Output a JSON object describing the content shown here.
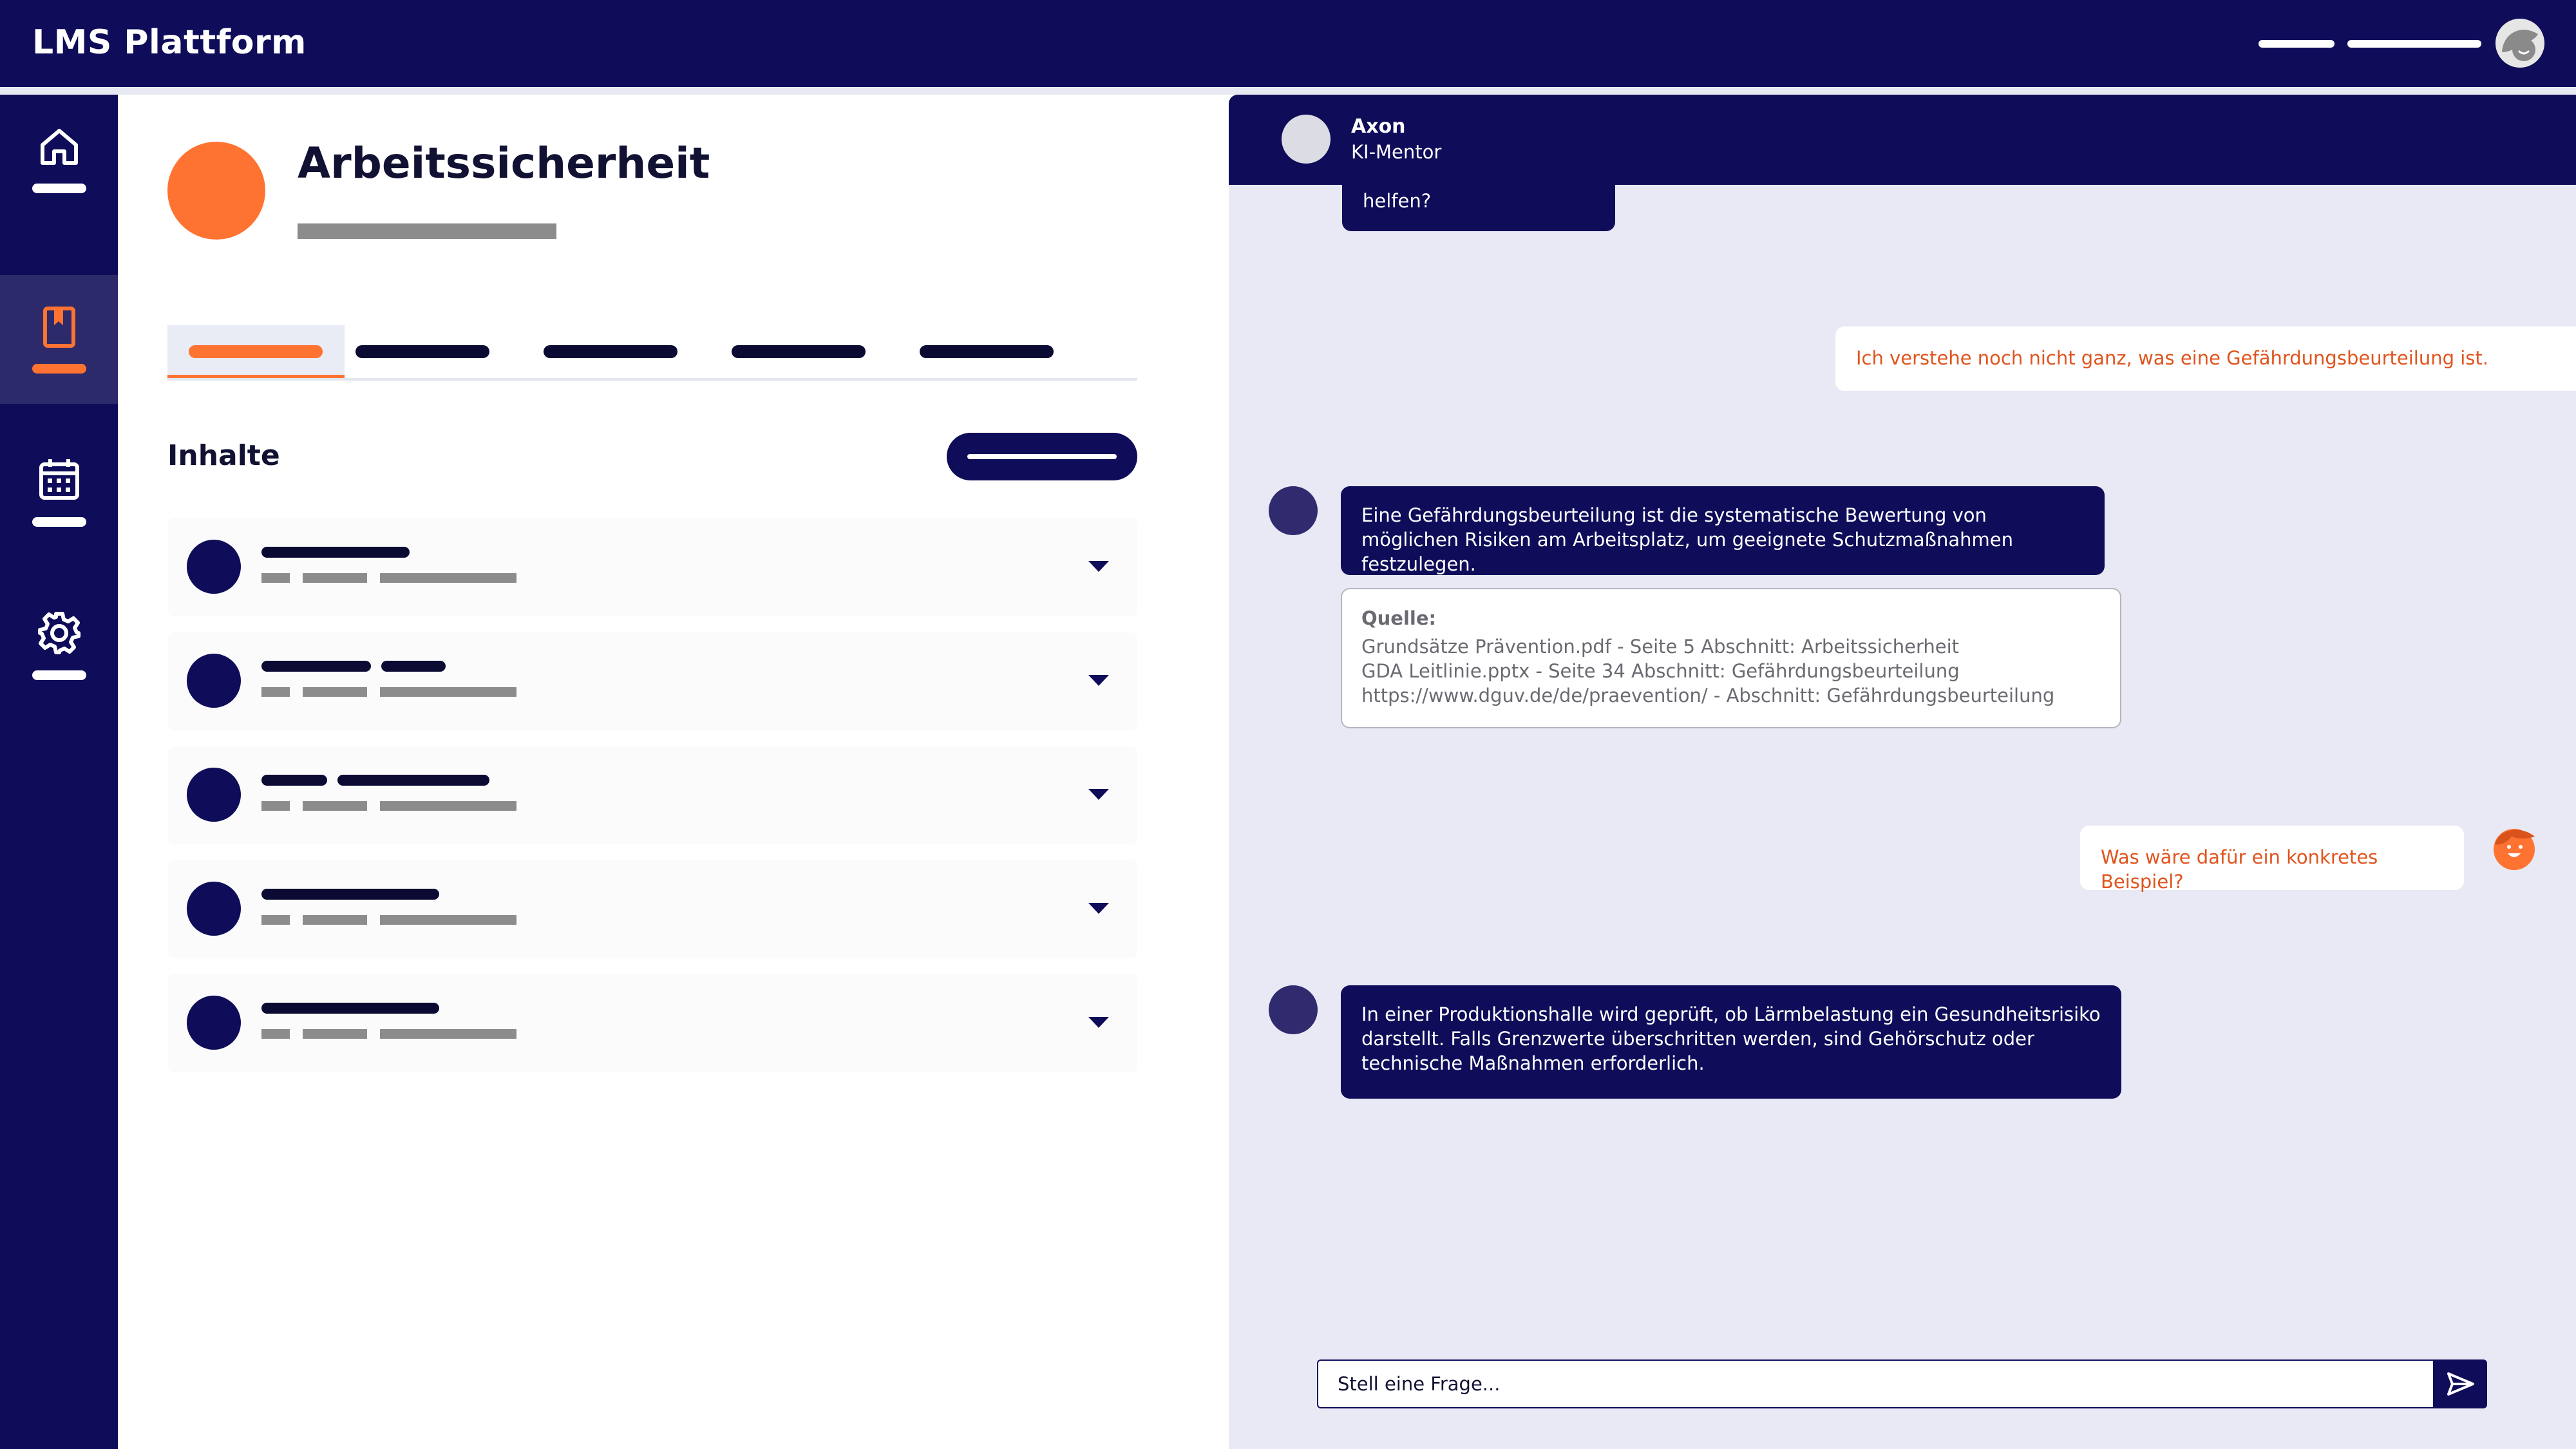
{
  "app": {
    "title": "LMS Plattform",
    "brand_color": "#0f0c59",
    "accent_color": "#ff7332"
  },
  "sidebar": {
    "items": [
      {
        "icon": "home-icon",
        "active": false
      },
      {
        "icon": "bookmark-book-icon",
        "active": true
      },
      {
        "icon": "calendar-icon",
        "active": false
      },
      {
        "icon": "gear-icon",
        "active": false
      }
    ]
  },
  "course": {
    "title": "Arbeitssicherheit",
    "section_title": "Inhalte",
    "tab_count": 5,
    "active_tab": 0,
    "item_count": 5
  },
  "chat": {
    "bot_name": "Axon",
    "bot_role": "KI-Mentor",
    "partial_message": "Wobei kann ich dir helfen?",
    "messages": [
      {
        "from": "user",
        "text": "Ich verstehe noch nicht ganz, was eine Gefährdungsbeurteilung ist."
      },
      {
        "from": "bot",
        "text": "Eine Gefährdungsbeurteilung ist die systematische Bewertung von möglichen Risiken am Arbeitsplatz, um geeignete Schutzmaßnahmen festzulegen."
      },
      {
        "from": "user",
        "text": "Was wäre dafür ein konkretes Beispiel?"
      },
      {
        "from": "bot",
        "text": "In einer Produktionshalle wird geprüft, ob Lärmbelastung ein Gesundheitsrisiko darstellt. Falls Grenzwerte überschritten werden, sind Gehörschutz oder technische Maßnahmen erforderlich."
      }
    ],
    "source": {
      "label": "Quelle:",
      "lines": [
        "Grundsätze Prävention.pdf - Seite 5 Abschnitt: Arbeitssicherheit",
        "GDA Leitlinie.pptx - Seite 34 Abschnitt: Gefährdungsbeurteilung",
        "https://www.dguv.de/de/praevention/ - Abschnitt: Gefährdungsbeurteilung"
      ]
    },
    "input_placeholder": "Stell eine Frage...",
    "send_icon": "send-icon"
  }
}
